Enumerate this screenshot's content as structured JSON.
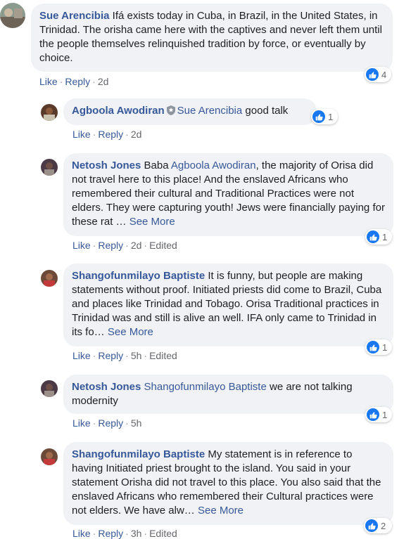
{
  "colors": {
    "link": "#365899",
    "bubble": "#f0f2f5",
    "like": "#1877f2",
    "meta": "#65676b"
  },
  "comments": [
    {
      "author": "Sue Arencibia",
      "text": " Ifá exists today in Cuba, in Brazil, in the United States, in Trinidad. The orisha came here with the captives and never left them until the people themselves relinquished tradition by force, or eventually by choice.",
      "actions": {
        "like": "Like",
        "reply": "Reply",
        "time": "2d"
      },
      "reactions": "4"
    },
    {
      "author": "Agboola Awodiran",
      "badge_icon": "shield-badge-icon",
      "mention": "Sue Arencibia",
      "text": " good talk",
      "actions": {
        "like": "Like",
        "reply": "Reply",
        "time": "2d"
      },
      "reactions": "1"
    },
    {
      "author": "Netosh Jones",
      "text_pre": " Baba ",
      "mention": "Agboola Awodiran",
      "text": ", the majority of Orisa did not travel here to this place! And the enslaved Africans who remembered their cultural and Traditional Practices were not elders. They were capturing youth! Jews were financially paying for these rat … ",
      "see_more": "See More",
      "actions": {
        "like": "Like",
        "reply": "Reply",
        "time": "2d",
        "edited": "Edited"
      },
      "reactions": "1"
    },
    {
      "author": "Shangofunmilayo Baptiste",
      "text": " It is funny, but people are making statements without proof. Initiated priests did come to Brazil, Cuba and places like Trinidad and Tobago. Orisa Traditional practices in Trinidad was and still is alive an well. IFA only came to Trinidad in its fo… ",
      "see_more": "See More",
      "actions": {
        "like": "Like",
        "reply": "Reply",
        "time": "5h",
        "edited": "Edited"
      },
      "reactions": "1"
    },
    {
      "author": "Netosh Jones",
      "mention": "Shangofunmilayo Baptiste",
      "text": " we are not talking modernity",
      "actions": {
        "like": "Like",
        "reply": "Reply",
        "time": "5h"
      },
      "reactions": "1"
    },
    {
      "author": "Shangofunmilayo Baptiste",
      "text": " My statement is in reference to having Initiated priest brought to the island. You said in your statement Orisha did not travel to this place. You also said that the enslaved Africans who remembered their Cultural practices were not elders. We have alw… ",
      "see_more": "See More",
      "actions": {
        "like": "Like",
        "reply": "Reply",
        "time": "3h",
        "edited": "Edited"
      },
      "reactions": "2"
    }
  ]
}
